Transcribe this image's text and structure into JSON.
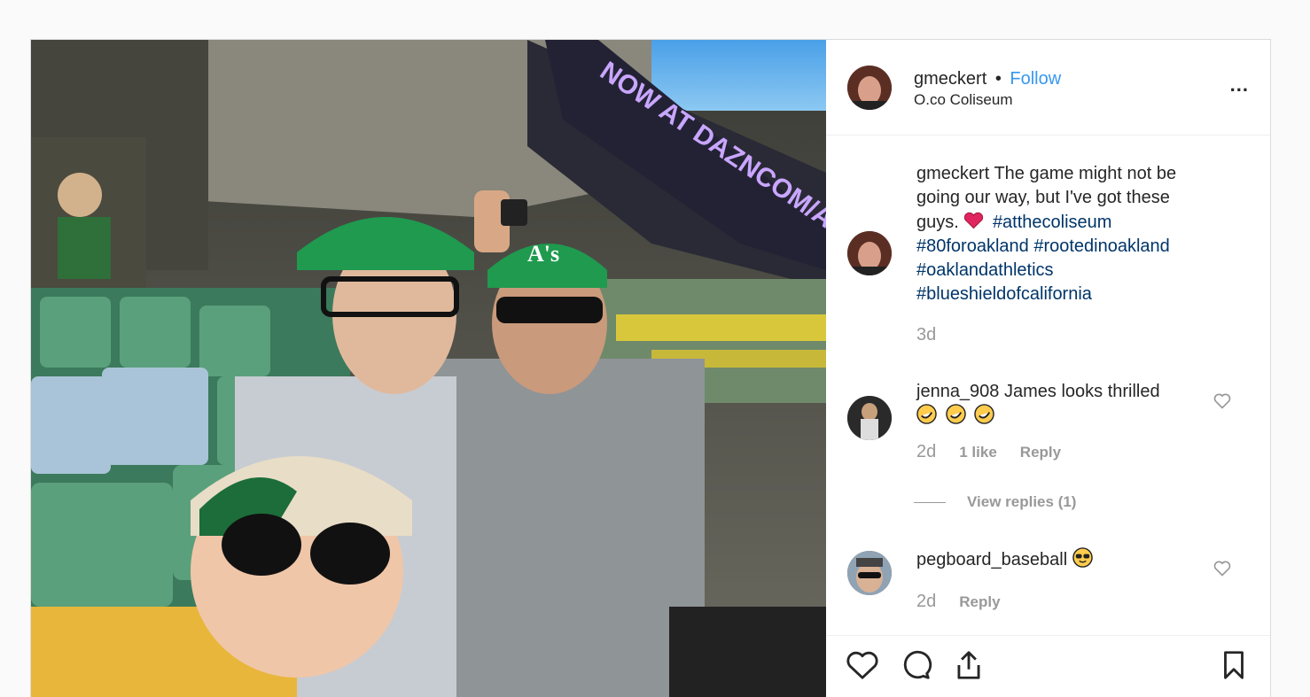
{
  "post": {
    "header": {
      "username": "gmeckert",
      "separator": "•",
      "follow_label": "Follow",
      "location": "O.co Coliseum",
      "more_label": "..."
    },
    "photo": {
      "banner_text": "NOW AT DAZNCOM/ATHLETICS",
      "cap_logo": "A's"
    },
    "caption": {
      "username": "gmeckert",
      "text": "The game might not be going our way, but I've got these guys.",
      "emoji": "heart-emoji",
      "hashtags": [
        "#atthecoliseum",
        "#80foroakland",
        "#rootedinoakland",
        "#oaklandathletics",
        "#blueshieldofcalifornia"
      ],
      "time": "3d"
    },
    "comments": [
      {
        "username": "jenna_908",
        "text": "James looks thrilled",
        "emojis": [
          "rofl-emoji",
          "rofl-emoji",
          "rofl-emoji"
        ],
        "time": "2d",
        "likes": "1 like",
        "reply_label": "Reply",
        "view_replies": "View replies (1)"
      },
      {
        "username": "pegboard_baseball",
        "text": "",
        "emojis": [
          "sunglasses-emoji"
        ],
        "time": "2d",
        "reply_label": "Reply"
      }
    ],
    "actions": [
      "like-icon",
      "comment-icon",
      "share-icon",
      "save-icon"
    ],
    "colors": {
      "follow": "#3897f0",
      "hashtag": "#003569",
      "meta": "#999999",
      "cap_green": "#1f9a4f"
    }
  }
}
